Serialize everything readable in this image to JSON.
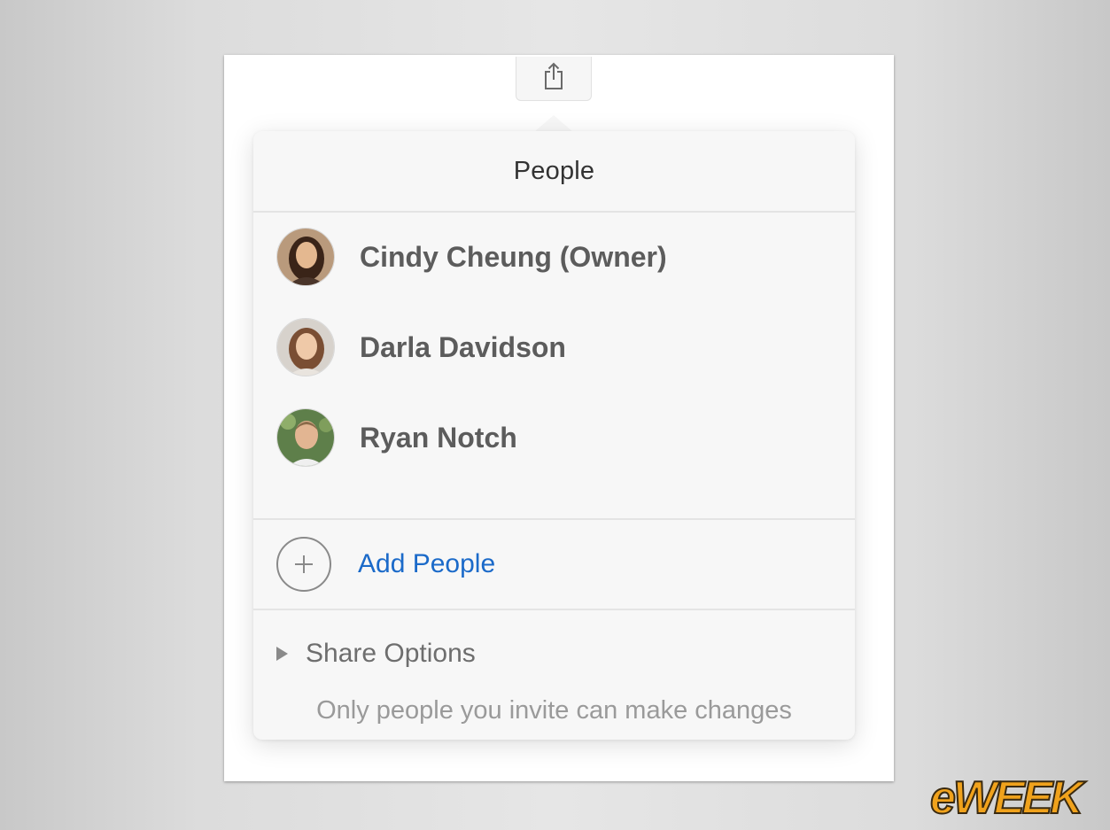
{
  "popover": {
    "title": "People",
    "people": [
      {
        "name": "Cindy Cheung (Owner)",
        "avatar": "cindy-avatar"
      },
      {
        "name": "Darla Davidson",
        "avatar": "darla-avatar"
      },
      {
        "name": "Ryan Notch",
        "avatar": "ryan-avatar"
      }
    ],
    "add_label": "Add People",
    "share_options_label": "Share Options",
    "permission_note": "Only people you invite can make changes"
  },
  "toolbar": {
    "share_icon": "share-icon"
  },
  "watermark": {
    "text": "eWEEK"
  },
  "colors": {
    "link": "#1b6ac9",
    "background": "#e0e0e0",
    "popover": "#f7f7f7"
  }
}
